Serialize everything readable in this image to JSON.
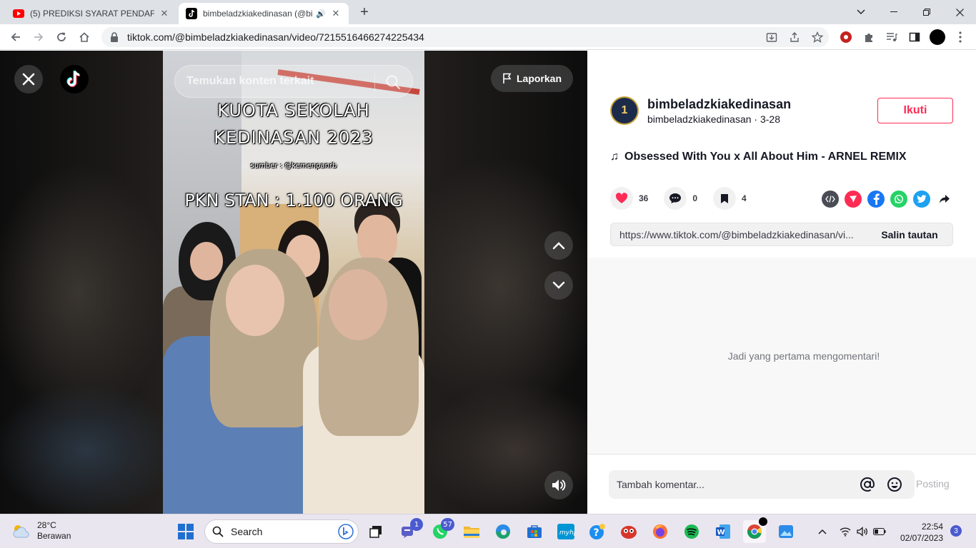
{
  "browser": {
    "tabs": [
      {
        "title": "(5) PREDIKSI SYARAT PENDAFTAR",
        "favicon": "youtube-icon"
      },
      {
        "title": "bimbeladzkiakedinasan (@bi",
        "favicon": "tiktok-icon",
        "audio": true
      }
    ],
    "new_tab": "+",
    "url": "tiktok.com/@bimbeladzkiakedinasan/video/7215516466274225434"
  },
  "video": {
    "search_placeholder": "Temukan konten terkait",
    "report_label": "Laporkan",
    "overlay_text": {
      "line1": "KUOTA  SEKOLAH",
      "line2": "KEDINASAN 2023",
      "line3": "sumber : @kemenpanrb",
      "line4": "PKN STAN : 1.100 ORANG"
    }
  },
  "panel": {
    "username": "bimbeladzkiakedinasan",
    "subline": "bimbeladzkiakedinasan · 3-28",
    "follow_label": "Ikuti",
    "music": "Obsessed With You x All About Him - ARNEL REMIX",
    "likes": "36",
    "comments": "0",
    "saves": "4",
    "link_url": "https://www.tiktok.com/@bimbeladzkiakedinasan/vi...",
    "copy_label": "Salin tautan",
    "empty_comments": "Jadi yang pertama mengomentari!",
    "comment_placeholder": "Tambah komentar...",
    "post_label": "Posting"
  },
  "taskbar": {
    "weather_temp": "28°C",
    "weather_desc": "Berawan",
    "search_label": "Search",
    "badges": {
      "teams": "1",
      "whatsapp": "57"
    },
    "time": "22:54",
    "date": "02/07/2023",
    "notifications": "3"
  },
  "colors": {
    "accent": "#fe2c55",
    "like": "#fe2c55"
  }
}
